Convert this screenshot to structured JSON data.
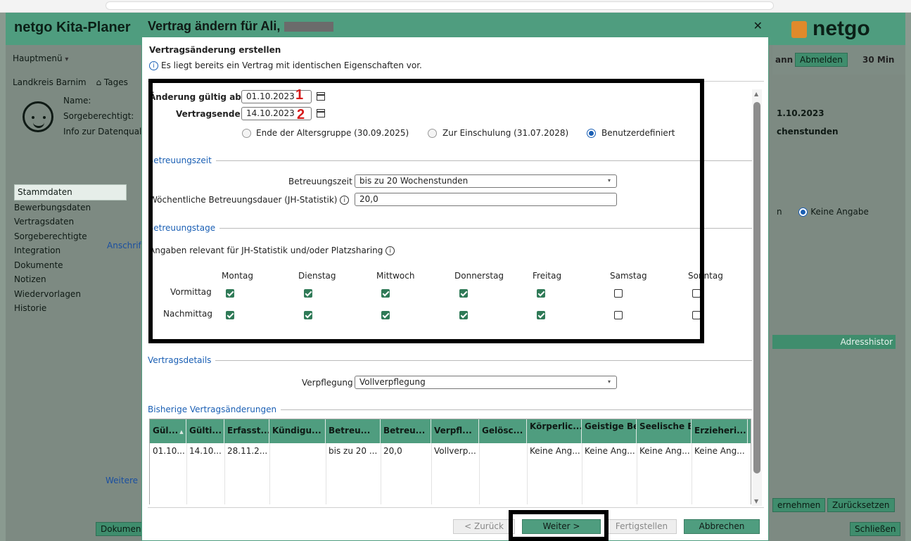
{
  "app": {
    "title": "netgo Kita-Planer",
    "brand": "netgo",
    "menu": "Hauptmenü",
    "menu_arrow": "▾",
    "breadcrumb": "Landkreis Barnim",
    "tab_partial": "Tages",
    "labels": {
      "name": "Name:",
      "guardian": "Sorgeberechtigt:",
      "data_quality": "Info zur Datenqual"
    },
    "nav": [
      {
        "label": "Stammdaten",
        "active": true
      },
      {
        "label": "Bewerbungsdaten"
      },
      {
        "label": "Vertragsdaten"
      },
      {
        "label": "Sorgeberechtigte"
      },
      {
        "label": "Integration"
      },
      {
        "label": "Dokumente"
      },
      {
        "label": "Notizen"
      },
      {
        "label": "Wiedervorlagen"
      },
      {
        "label": "Historie"
      }
    ],
    "link_partial": "Anschrif",
    "more_partial": "Weitere",
    "docs_partial": "Dokumen",
    "right": {
      "user_partial": "ann",
      "logout": "Abmelden",
      "timer": "30 Min",
      "date_partial": "1.10.2023",
      "hours_partial": "chenstunden",
      "radio_partial": "n",
      "keine": "Keine Angabe",
      "address_history": "Adresshistor",
      "take_over": "ernehmen",
      "reset": "Zurücksetzen",
      "close": "Schließen"
    }
  },
  "modal": {
    "title": "Vertrag ändern für",
    "title_name_partial": "Ali,",
    "close_glyph": "✕",
    "subtitle": "Vertragsänderung erstellen",
    "info_glyph": "i",
    "info": "Es liegt bereits ein Vertrag mit identischen Eigenschaften vor.",
    "valid_from": {
      "label": "Änderung gültig ab",
      "value": "01.10.2023",
      "marker": "1"
    },
    "contract_end": {
      "label": "Vertragsende",
      "value": "14.10.2023",
      "marker": "2"
    },
    "end_options": [
      {
        "label": "Ende der Altersgruppe (30.09.2025)",
        "selected": false
      },
      {
        "label": "Zur Einschulung (31.07.2028)",
        "selected": false
      },
      {
        "label": "Benutzerdefiniert",
        "selected": true
      }
    ],
    "sections": {
      "care_time": "Betreuungszeit",
      "care_days": "Betreuungstage",
      "contract_details": "Vertragsdetails",
      "history": "Bisherige Vertragsänderungen"
    },
    "care_time_label": "Betreuungszeit",
    "care_time_value": "bis zu 20 Wochenstunden",
    "weekly_label": "Wöchentliche Betreuungsdauer (JH-Statistik)",
    "weekly_value": "20,0",
    "days_note": "Angaben relevant für JH-Statistik und/oder Platzsharing",
    "days": [
      "Montag",
      "Dienstag",
      "Mittwoch",
      "Donnerstag",
      "Freitag",
      "Samstag",
      "Sonntag"
    ],
    "rows": [
      {
        "label": "Vormittag",
        "checked": [
          true,
          true,
          true,
          true,
          true,
          false,
          false
        ]
      },
      {
        "label": "Nachmittag",
        "checked": [
          true,
          true,
          true,
          true,
          true,
          false,
          false
        ]
      }
    ],
    "meal_label": "Verpflegung",
    "meal_value": "Vollverpflegung",
    "dropdown_glyph": "▾",
    "table": {
      "headers": [
        "Gül...",
        "Gülti...",
        "Erfasst...",
        "Kündigu...",
        "Betreu...",
        "Betreu...",
        "Verpfl...",
        "Gelösc...",
        "Körperlic... Behinder...",
        "Geistige Behinder...",
        "Seelische Behinder...",
        "Erzieheri..."
      ],
      "sort_glyph": "▲",
      "row": [
        "01.10...",
        "14.10...",
        "28.11.2...",
        "",
        "bis zu 20 ...",
        "20,0",
        "Vollverp...",
        "",
        "Keine Ang...",
        "Keine Ang...",
        "Keine Ang...",
        "Keine Ang..."
      ]
    },
    "buttons": {
      "back": "< Zurück",
      "next": "Weiter >",
      "finish": "Fertigstellen",
      "cancel": "Abbrechen"
    }
  }
}
